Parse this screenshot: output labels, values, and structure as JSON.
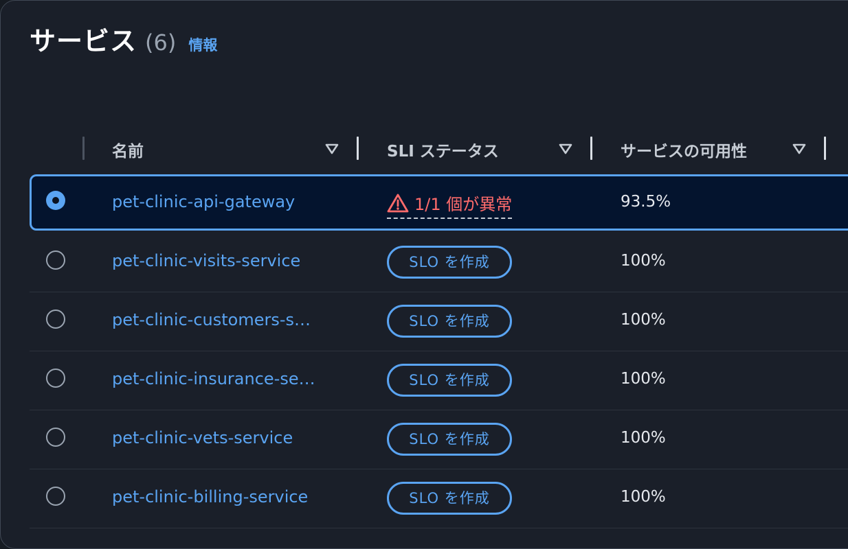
{
  "header": {
    "title": "サービス",
    "count": "(6)",
    "info_link": "情報"
  },
  "table": {
    "columns": [
      {
        "label": "名前"
      },
      {
        "label": "SLI ステータス"
      },
      {
        "label": "サービスの可用性"
      }
    ],
    "rows": [
      {
        "name": "pet-clinic-api-gateway",
        "selected": true,
        "sli_status": "1/1 個が異常",
        "sli_type": "warning",
        "availability": "93.5%"
      },
      {
        "name": "pet-clinic-visits-service",
        "selected": false,
        "sli_status": "SLO を作成",
        "sli_type": "button",
        "availability": "100%"
      },
      {
        "name": "pet-clinic-customers-s…",
        "selected": false,
        "sli_status": "SLO を作成",
        "sli_type": "button",
        "availability": "100%"
      },
      {
        "name": "pet-clinic-insurance-se…",
        "selected": false,
        "sli_status": "SLO を作成",
        "sli_type": "button",
        "availability": "100%"
      },
      {
        "name": "pet-clinic-vets-service",
        "selected": false,
        "sli_status": "SLO を作成",
        "sli_type": "button",
        "availability": "100%"
      },
      {
        "name": "pet-clinic-billing-service",
        "selected": false,
        "sli_status": "SLO を作成",
        "sli_type": "button",
        "availability": "100%"
      }
    ]
  },
  "icons": {
    "sort": "sort-triangle-down-icon",
    "warning": "warning-triangle-icon",
    "radio": "radio-button-icon"
  },
  "colors": {
    "background": "#1a1f29",
    "link": "#5aa4f2",
    "warning": "#ff6b6b",
    "selected_row_bg": "#04142e",
    "text": "#e6e9ee",
    "header_text": "#c6ccd4"
  }
}
